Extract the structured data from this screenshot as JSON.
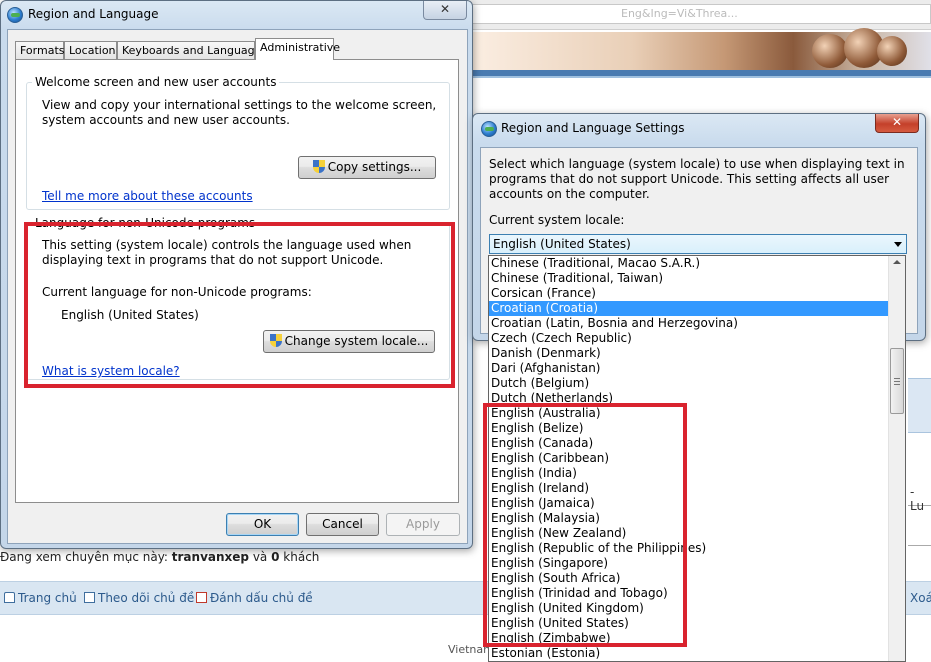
{
  "background": {
    "url_fragment": "Eng&Ing=Vi&Threa...",
    "forum_viewing_prefix": "Đang xem chuyên mục này: ",
    "forum_viewing_user": "tranvanxep",
    "forum_viewing_mid": " và ",
    "forum_viewing_count": "0",
    "forum_viewing_suffix": " khách",
    "nav": [
      "Trang chủ",
      "Theo dõi chủ đề",
      "Đánh dấu chủ đề"
    ],
    "footer": "Vietnam",
    "right_partial_1": "- Lu",
    "right_partial_2": "Xoá"
  },
  "region_window": {
    "title": "Region and Language",
    "close_label": "✕",
    "tabs": [
      "Formats",
      "Location",
      "Keyboards and Languages",
      "Administrative"
    ],
    "active_tab": "Administrative",
    "welcome_group": {
      "legend": "Welcome screen and new user accounts",
      "description": "View and copy your international settings to the welcome screen, system accounts and new user accounts.",
      "copy_button": "Copy settings...",
      "link": "Tell me more about these accounts"
    },
    "nonunicode_group": {
      "legend": "Language for non-Unicode programs",
      "description": "This setting (system locale) controls the language used when displaying text in programs that do not support Unicode.",
      "current_label": "Current language for non-Unicode programs:",
      "current_value": "English (United States)",
      "change_button": "Change system locale...",
      "link": "What is system locale?"
    },
    "buttons": {
      "ok": "OK",
      "cancel": "Cancel",
      "apply": "Apply"
    }
  },
  "settings_window": {
    "title": "Region and Language Settings",
    "close_label": "✕",
    "description": "Select which language (system locale) to use when displaying text in programs that do not support Unicode. This setting affects all user accounts on the computer.",
    "current_label": "Current system locale:",
    "current_value": "English (United States)",
    "options": [
      "Chinese (Traditional, Macao S.A.R.)",
      "Chinese (Traditional, Taiwan)",
      "Corsican (France)",
      "Croatian (Croatia)",
      "Croatian (Latin, Bosnia and Herzegovina)",
      "Czech (Czech Republic)",
      "Danish (Denmark)",
      "Dari (Afghanistan)",
      "Dutch (Belgium)",
      "Dutch (Netherlands)",
      "English (Australia)",
      "English (Belize)",
      "English (Canada)",
      "English (Caribbean)",
      "English (India)",
      "English (Ireland)",
      "English (Jamaica)",
      "English (Malaysia)",
      "English (New Zealand)",
      "English (Republic of the Philippines)",
      "English (Singapore)",
      "English (South Africa)",
      "English (Trinidad and Tobago)",
      "English (United Kingdom)",
      "English (United States)",
      "English (Zimbabwe)",
      "Estonian (Estonia)"
    ],
    "highlighted_option": "Croatian (Croatia)"
  },
  "colors": {
    "highlight": "#3399ff",
    "annotation_red": "#d9232e",
    "link": "#0033cc"
  }
}
